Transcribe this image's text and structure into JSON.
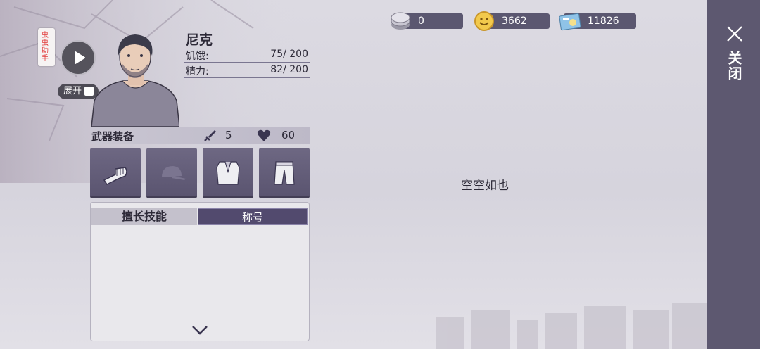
{
  "currencies": [
    {
      "icon": "silver-coin-icon",
      "value": "0"
    },
    {
      "icon": "gold-coin-icon",
      "value": "3662"
    },
    {
      "icon": "ticket-icon",
      "value": "11826"
    }
  ],
  "sidebar": {
    "close_label": "关闭"
  },
  "helper": {
    "tag_label": "虫虫助手",
    "expand_label": "展开"
  },
  "character": {
    "name": "尼克",
    "hunger_label": "饥饿:",
    "hunger_value": "75/ 200",
    "energy_label": "精力:",
    "energy_value": "82/ 200"
  },
  "equipment": {
    "title": "武器装备",
    "attack": "5",
    "health": "60",
    "slots": [
      "fist-icon",
      "cap-icon",
      "vest-icon",
      "shorts-icon"
    ]
  },
  "tabs": {
    "skills": "擅长技能",
    "titles": "称号"
  },
  "empty_message": "空空如也",
  "colors": {
    "panel": "#5d5870",
    "accent": "#524a6e"
  }
}
